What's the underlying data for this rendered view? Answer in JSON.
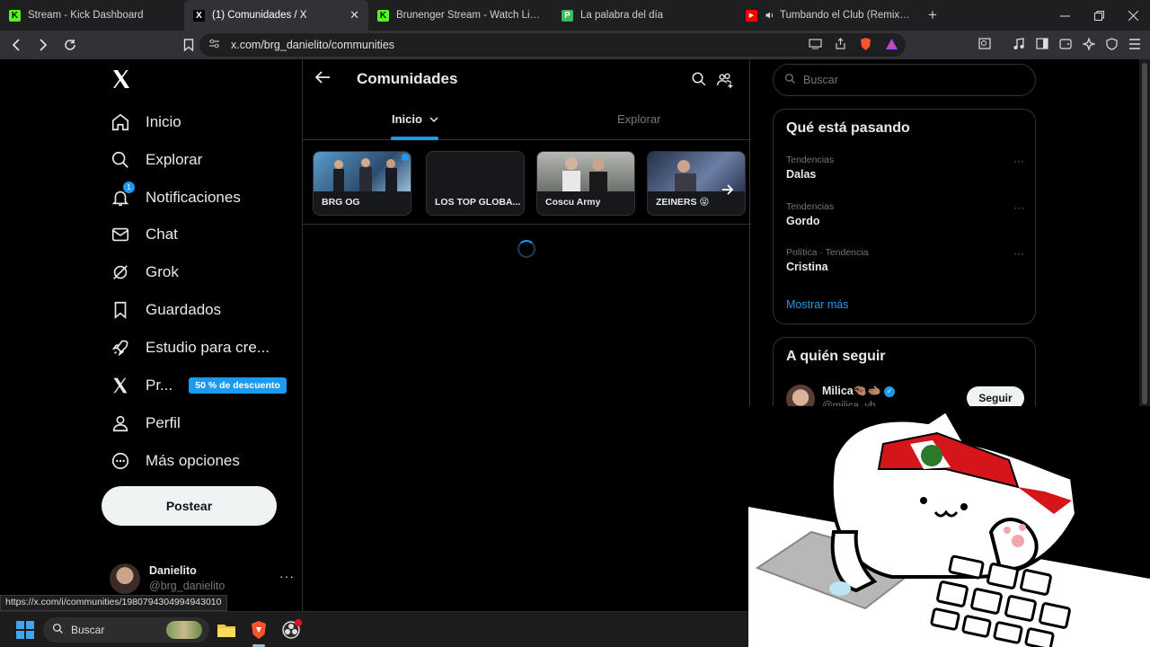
{
  "browser": {
    "tabs": [
      {
        "title": "Stream - Kick Dashboard",
        "favicon_color": "#53fc18",
        "favicon_letter": "K"
      },
      {
        "title": "(1) Comunidades / X",
        "favicon_color": "#ffffff",
        "favicon_letter": "X",
        "active": true,
        "close": "✕"
      },
      {
        "title": "Brunenger Stream - Watch Live on Kick",
        "favicon_color": "#53fc18",
        "favicon_letter": "K"
      },
      {
        "title": "La palabra del día",
        "favicon_color": "#3dbb5c",
        "favicon_letter": "P"
      },
      {
        "title": "Tumbando el Club (Remix) (Official",
        "favicon_color": "#ff0000",
        "favicon_letter": "▶"
      }
    ],
    "new_tab": "+",
    "url": "x.com/brg_danielito/communities",
    "status_url": "https://x.com/i/communities/1980794304994943010"
  },
  "sidebar": {
    "logo": "X",
    "items": [
      {
        "label": "Inicio",
        "icon": "home-icon"
      },
      {
        "label": "Explorar",
        "icon": "search-icon"
      },
      {
        "label": "Notificaciones",
        "icon": "bell-icon",
        "badge": "1"
      },
      {
        "label": "Chat",
        "icon": "mail-icon"
      },
      {
        "label": "Grok",
        "icon": "grok-icon"
      },
      {
        "label": "Guardados",
        "icon": "bookmark-icon"
      },
      {
        "label": "Estudio para cre...",
        "icon": "rocket-icon"
      },
      {
        "label": "Pr...",
        "icon": "x-premium-icon",
        "promo": "50 % de descuento"
      },
      {
        "label": "Perfil",
        "icon": "person-icon"
      },
      {
        "label": "Más opciones",
        "icon": "more-circle-icon"
      }
    ],
    "post_button": "Postear",
    "profile": {
      "name": "Danielito",
      "handle": "@brg_danielito",
      "more": "···"
    }
  },
  "main": {
    "title": "Comunidades",
    "tabs": [
      {
        "label": "Inicio",
        "dropdown": "⌄"
      },
      {
        "label": "Explorar"
      }
    ],
    "communities": [
      {
        "label": "BRG OG",
        "image_color": "#4a7ea8",
        "unread": true
      },
      {
        "label": "LOS TOP GLOBA...",
        "image_color": "#16181c"
      },
      {
        "label": "Coscu Army",
        "image_color": "#8a8f88"
      },
      {
        "label": "ZEINERS 😝",
        "image_color": "#3e4d6a"
      }
    ]
  },
  "right": {
    "search_placeholder": "Buscar",
    "trends_title": "Qué está pasando",
    "trends": [
      {
        "meta": "Tendencias",
        "name": "Dalas"
      },
      {
        "meta": "Tendencias",
        "name": "Gordo"
      },
      {
        "meta": "Política · Tendencia",
        "name": "Cristina"
      }
    ],
    "trend_more": "···",
    "show_more": "Mostrar más",
    "follow_title": "A quién seguir",
    "follow": {
      "name": "Milica🤏🏽🫲🏽",
      "verified": "✓",
      "handle": "@milica_vh",
      "button": "Seguir"
    }
  },
  "taskbar": {
    "search_placeholder": "Buscar"
  },
  "colors": {
    "accent": "#1d9bf0",
    "background": "#000000",
    "border": "#2f3336"
  }
}
